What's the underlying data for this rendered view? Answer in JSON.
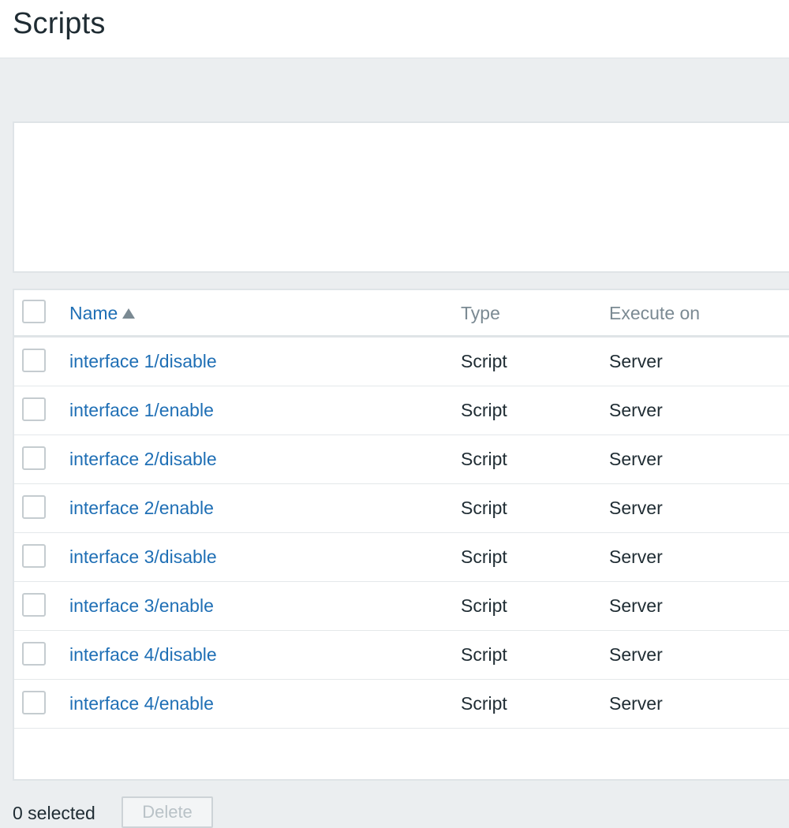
{
  "page": {
    "title": "Scripts"
  },
  "table": {
    "columns": {
      "name": "Name",
      "type": "Type",
      "execute_on": "Execute on"
    },
    "sort_column": "name",
    "sort_direction": "ascending",
    "rows": [
      {
        "name": "interface 1/disable",
        "type": "Script",
        "execute_on": "Server"
      },
      {
        "name": "interface 1/enable",
        "type": "Script",
        "execute_on": "Server"
      },
      {
        "name": "interface 2/disable",
        "type": "Script",
        "execute_on": "Server"
      },
      {
        "name": "interface 2/enable",
        "type": "Script",
        "execute_on": "Server"
      },
      {
        "name": "interface 3/disable",
        "type": "Script",
        "execute_on": "Server"
      },
      {
        "name": "interface 3/enable",
        "type": "Script",
        "execute_on": "Server"
      },
      {
        "name": "interface 4/disable",
        "type": "Script",
        "execute_on": "Server"
      },
      {
        "name": "interface 4/enable",
        "type": "Script",
        "execute_on": "Server"
      }
    ]
  },
  "footer": {
    "selected_text": "0 selected",
    "delete_label": "Delete"
  },
  "colors": {
    "link": "#1f6fb5",
    "background": "#ebeef0",
    "border": "#dfe4e7",
    "muted_text": "#7b8a93"
  },
  "icons": {
    "sort": "sort-ascending-icon"
  }
}
